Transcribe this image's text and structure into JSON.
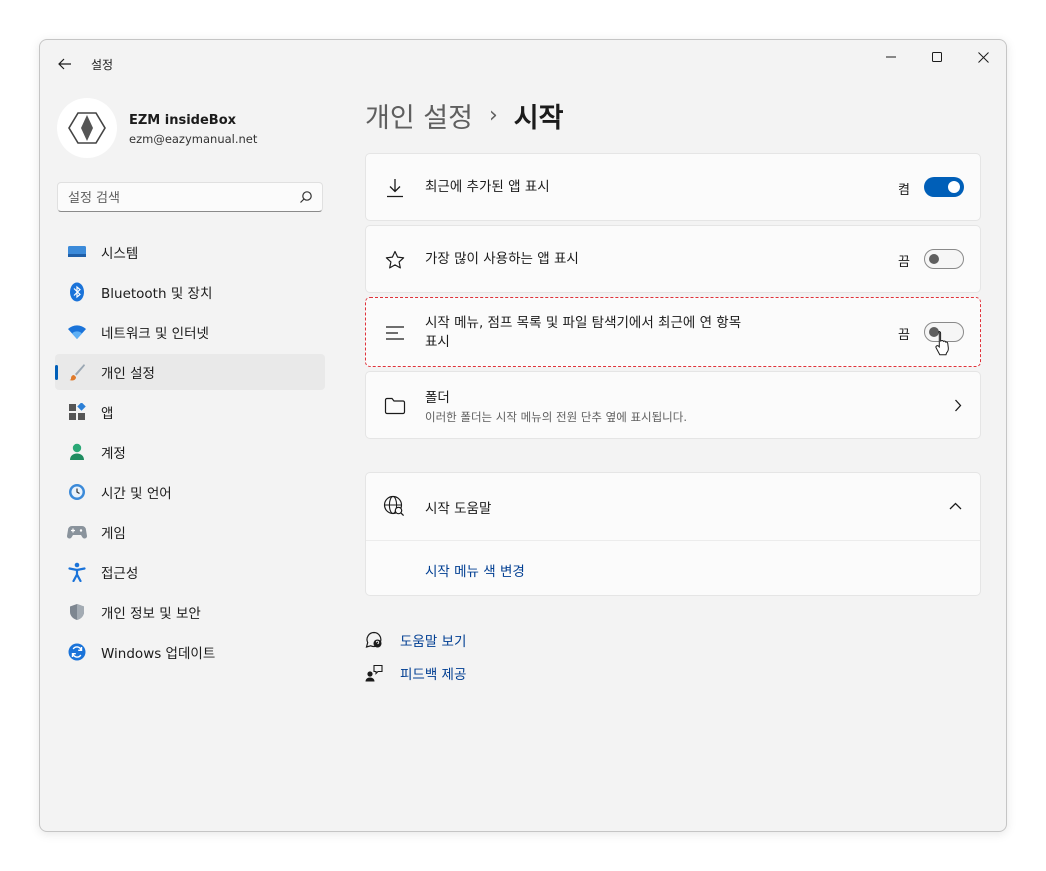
{
  "window": {
    "title": "설정"
  },
  "profile": {
    "name": "EZM insideBox",
    "email": "ezm@eazymanual.net"
  },
  "search": {
    "placeholder": "설정 검색"
  },
  "sidebar": {
    "items": [
      {
        "label": "시스템",
        "icon": "monitor-icon"
      },
      {
        "label": "Bluetooth 및 장치",
        "icon": "bluetooth-icon"
      },
      {
        "label": "네트워크 및 인터넷",
        "icon": "wifi-icon"
      },
      {
        "label": "개인 설정",
        "icon": "brush-icon",
        "active": true
      },
      {
        "label": "앱",
        "icon": "apps-icon"
      },
      {
        "label": "계정",
        "icon": "person-icon"
      },
      {
        "label": "시간 및 언어",
        "icon": "clock-globe-icon"
      },
      {
        "label": "게임",
        "icon": "gamepad-icon"
      },
      {
        "label": "접근성",
        "icon": "accessibility-icon"
      },
      {
        "label": "개인 정보 및 보안",
        "icon": "shield-icon"
      },
      {
        "label": "Windows 업데이트",
        "icon": "update-icon"
      }
    ]
  },
  "breadcrumb": {
    "parent": "개인 설정",
    "separator": "›",
    "current": "시작"
  },
  "settings": {
    "recent_apps": {
      "label": "최근에 추가된 앱 표시",
      "state": "켬",
      "on": true
    },
    "most_used": {
      "label": "가장 많이 사용하는 앱 표시",
      "state": "끔",
      "on": false
    },
    "recent_items": {
      "label_line1": "시작 메뉴, 점프 목록 및 파일 탐색기에서 최근에 연 항목",
      "label_line2": "표시",
      "state": "끔",
      "on": false
    },
    "folders": {
      "label": "폴더",
      "description": "이러한 폴더는 시작 메뉴의 전원 단추 옆에 표시됩니다."
    }
  },
  "help": {
    "title": "시작 도움말",
    "link": "시작 메뉴 색 변경"
  },
  "footer": {
    "get_help": "도움말 보기",
    "feedback": "피드백 제공"
  },
  "colors": {
    "accent": "#005fb8",
    "highlight_border": "#e0323a"
  }
}
